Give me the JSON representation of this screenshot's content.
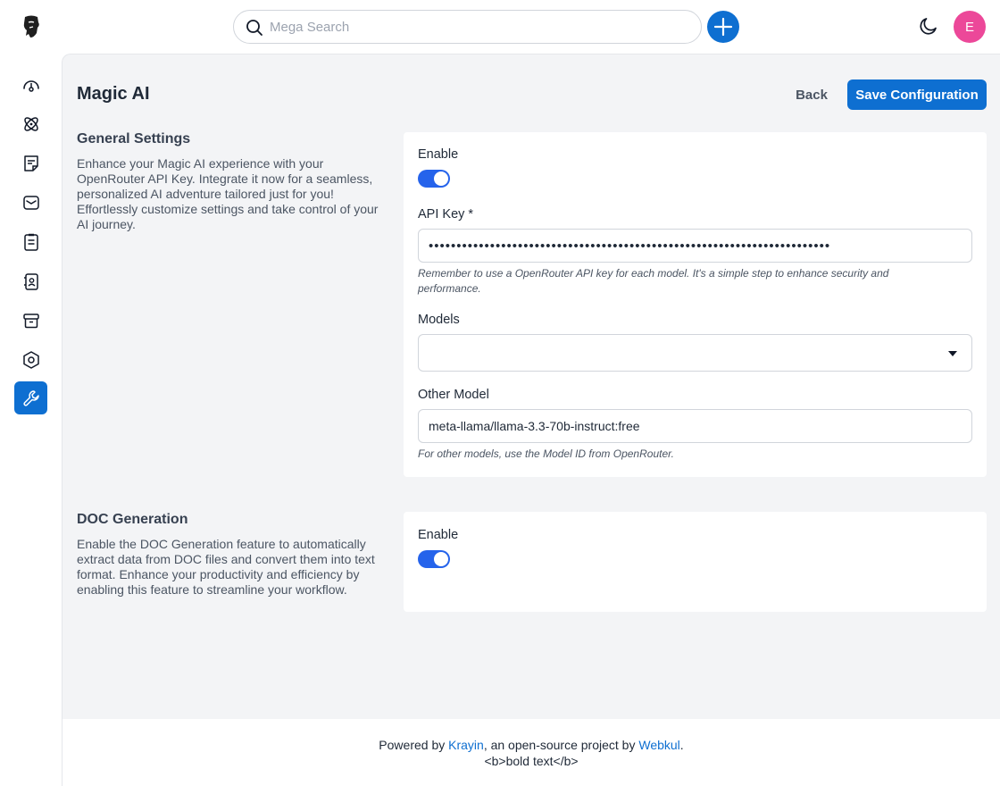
{
  "header": {
    "search_placeholder": "Mega Search",
    "avatar_initial": "E"
  },
  "sidebar": {
    "items": [
      {
        "name": "dashboard",
        "icon": "dashboard-gauge-icon",
        "active": false
      },
      {
        "name": "leads",
        "icon": "leads-icon",
        "active": false
      },
      {
        "name": "quotes",
        "icon": "quotes-icon",
        "active": false
      },
      {
        "name": "mail",
        "icon": "mail-icon",
        "active": false
      },
      {
        "name": "activities",
        "icon": "activities-icon",
        "active": false
      },
      {
        "name": "contacts",
        "icon": "contacts-icon",
        "active": false
      },
      {
        "name": "products",
        "icon": "products-icon",
        "active": false
      },
      {
        "name": "settings",
        "icon": "settings-icon",
        "active": false
      },
      {
        "name": "configuration",
        "icon": "wrench-icon",
        "active": true
      }
    ]
  },
  "page": {
    "title": "Magic AI",
    "back_label": "Back",
    "save_label": "Save Configuration"
  },
  "general": {
    "title": "General Settings",
    "description": "Enhance your Magic AI experience with your OpenRouter API Key. Integrate it now for a seamless, personalized AI adventure tailored just for you! Effortlessly customize settings and take control of your AI journey.",
    "enable_label": "Enable",
    "enabled": true,
    "api_key_label": "API Key *",
    "api_key_value": "••••••••••••••••••••••••••••••••••••••••••••••••••••••••••••••••••••••••",
    "api_key_hint": "Remember to use a OpenRouter API key for each model. It's a simple step to enhance security and performance.",
    "models_label": "Models",
    "models_value": "",
    "other_model_label": "Other Model",
    "other_model_value": "meta-llama/llama-3.3-70b-instruct:free",
    "other_model_hint": "For other models, use the Model ID from OpenRouter."
  },
  "doc": {
    "title": "DOC Generation",
    "description": "Enable the DOC Generation feature to automatically extract data from DOC files and convert them into text format. Enhance your productivity and efficiency by enabling this feature to streamline your workflow.",
    "enable_label": "Enable",
    "enabled": true
  },
  "footer": {
    "prefix": "Powered by ",
    "krayin": "Krayin",
    "middle": ", an open-source project by ",
    "webkul": "Webkul",
    "suffix": ".",
    "line2": "<b>bold text</b>"
  },
  "colors": {
    "primary": "#0e6fd1",
    "toggle_on": "#2563eb",
    "avatar": "#ec4899",
    "background": "#f3f4f6"
  }
}
